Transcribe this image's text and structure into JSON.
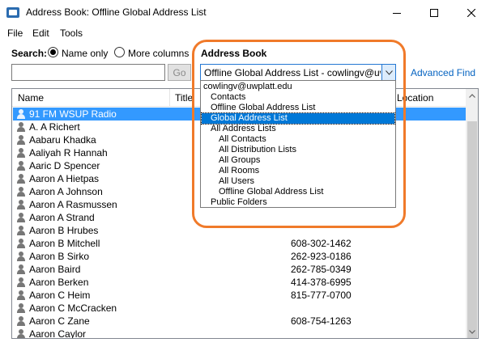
{
  "window": {
    "title": "Address Book: Offline Global Address List",
    "app_icon": "address-book-icon"
  },
  "menu": [
    "File",
    "Edit",
    "Tools"
  ],
  "search": {
    "label": "Search:",
    "radio_name_only": "Name only",
    "radio_more_columns": "More columns",
    "selected": "Name only",
    "input_value": "",
    "go_label": "Go"
  },
  "address_book": {
    "label": "Address Book",
    "selected_value": "Offline Global Address List - cowlingv@uwplatt.edu",
    "options": [
      {
        "label": "cowlingv@uwplatt.edu",
        "level": 0,
        "selected": false
      },
      {
        "label": "Contacts",
        "level": 1,
        "selected": false
      },
      {
        "label": "Offline Global Address List",
        "level": 1,
        "selected": false
      },
      {
        "label": "Global Address List",
        "level": 1,
        "selected": true
      },
      {
        "label": "All Address Lists",
        "level": 1,
        "selected": false
      },
      {
        "label": "All Contacts",
        "level": 2,
        "selected": false
      },
      {
        "label": "All Distribution Lists",
        "level": 2,
        "selected": false
      },
      {
        "label": "All Groups",
        "level": 2,
        "selected": false
      },
      {
        "label": "All Rooms",
        "level": 2,
        "selected": false
      },
      {
        "label": "All Users",
        "level": 2,
        "selected": false
      },
      {
        "label": "Offline Global Address List",
        "level": 2,
        "selected": false
      },
      {
        "label": "Public Folders",
        "level": 1,
        "selected": false
      }
    ]
  },
  "advanced_find": "Advanced Find",
  "list": {
    "columns": [
      "Name",
      "Title",
      "Location"
    ],
    "rows": [
      {
        "name": "91 FM WSUP Radio",
        "phone": "",
        "selected": true
      },
      {
        "name": "A. A Richert",
        "phone": ""
      },
      {
        "name": "Aabaru Khadka",
        "phone": ""
      },
      {
        "name": "Aaliyah R Hannah",
        "phone": ""
      },
      {
        "name": "Aaric D Spencer",
        "phone": ""
      },
      {
        "name": "Aaron A Hietpas",
        "phone": ""
      },
      {
        "name": "Aaron A Johnson",
        "phone": ""
      },
      {
        "name": "Aaron A Rasmussen",
        "phone": ""
      },
      {
        "name": "Aaron A Strand",
        "phone": ""
      },
      {
        "name": "Aaron B Hrubes",
        "phone": ""
      },
      {
        "name": "Aaron B Mitchell",
        "phone": "608-302-1462"
      },
      {
        "name": "Aaron B Sirko",
        "phone": "262-923-0186"
      },
      {
        "name": "Aaron Baird",
        "phone": "262-785-0349"
      },
      {
        "name": "Aaron Berken",
        "phone": "414-378-6995"
      },
      {
        "name": "Aaron C Heim",
        "phone": "815-777-0700"
      },
      {
        "name": "Aaron C McCracken",
        "phone": ""
      },
      {
        "name": "Aaron C Zane",
        "phone": "608-754-1263"
      },
      {
        "name": "Aaron Caylor",
        "phone": ""
      }
    ]
  },
  "colors": {
    "highlight_ring": "#f07a2a",
    "selection": "#3399ff",
    "dropdown_selection": "#0078d7",
    "link": "#0563c1"
  }
}
